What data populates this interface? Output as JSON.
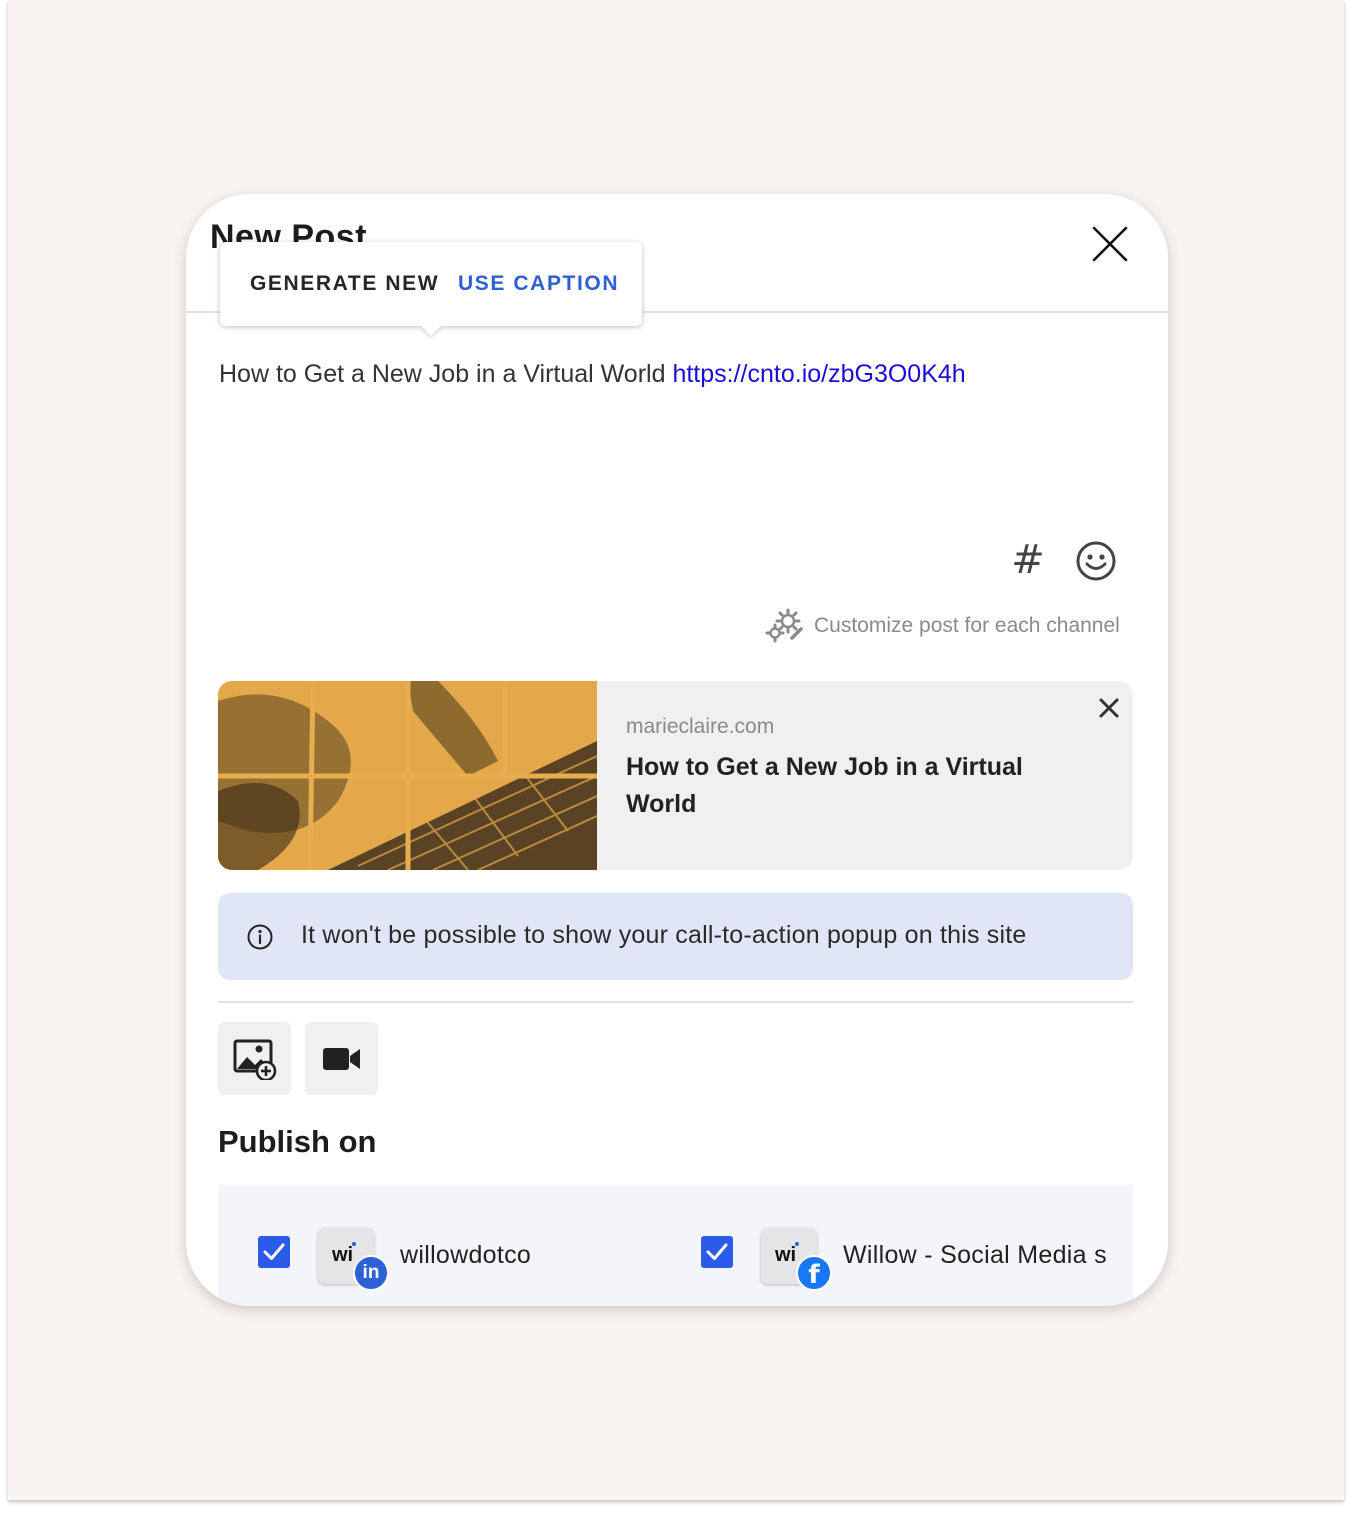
{
  "header": {
    "title": "New Post"
  },
  "caption_popup": {
    "generate_label": "GENERATE NEW",
    "use_caption_label": "USE CAPTION"
  },
  "post": {
    "text": "How to Get a New Job in a Virtual World",
    "link": "https://cnto.io/zbG3O0K4h"
  },
  "tools": {
    "hashtag_symbol": "#",
    "customize_label": "Customize post for each channel"
  },
  "link_preview": {
    "domain": "marieclaire.com",
    "title": "How to Get a New Job in a Virtual World"
  },
  "info_banner": {
    "text": "It won't be possible to show your call-to-action popup on this site"
  },
  "publish": {
    "title": "Publish on",
    "channels": [
      {
        "avatar_text": "wi",
        "network": "linkedin",
        "badge": "in",
        "name": "willowdotco",
        "checked": true
      },
      {
        "avatar_text": "wi",
        "network": "facebook",
        "badge": "f",
        "name": "Willow - Social Media s",
        "checked": true
      }
    ]
  },
  "colors": {
    "accent": "#2c5ae9",
    "link": "#1a0ddb",
    "banner_bg": "#e1e6f7",
    "thumbnail_tint": "#e2a84a"
  }
}
